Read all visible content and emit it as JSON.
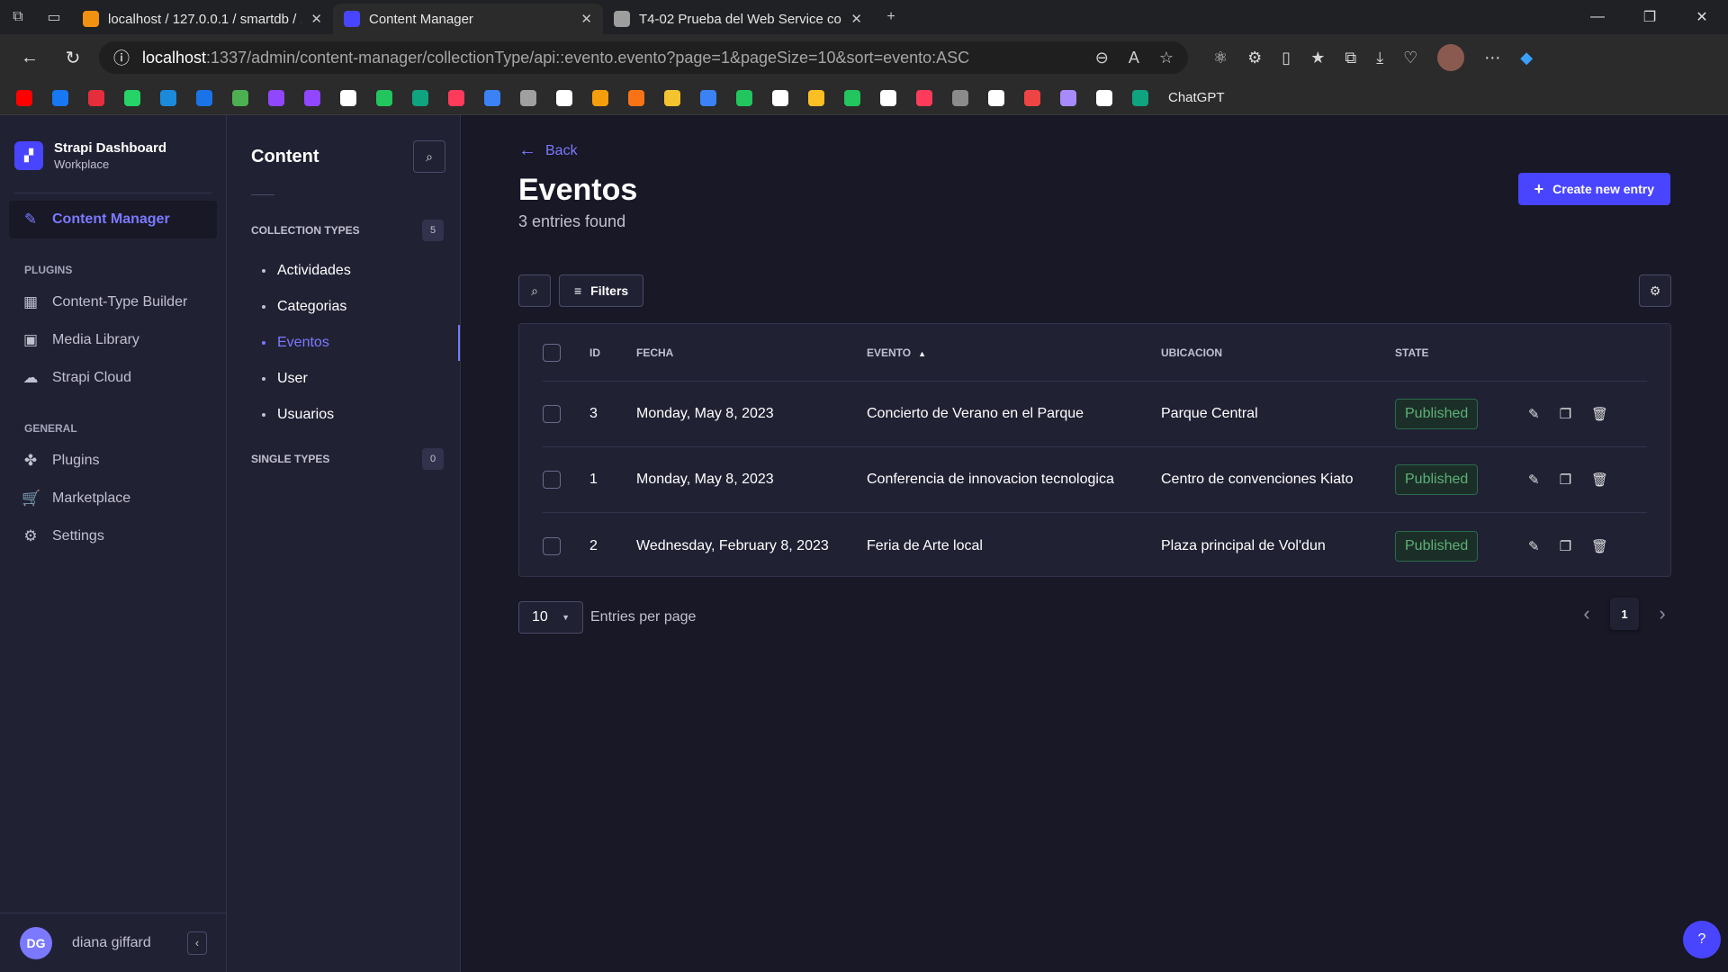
{
  "browser": {
    "tabs": [
      {
        "title": "localhost / 127.0.0.1 / smartdb / ...",
        "favicon_color": "#f29111",
        "active": false
      },
      {
        "title": "Content Manager",
        "favicon_color": "#4945ff",
        "active": true
      },
      {
        "title": "T4-02 Prueba del Web Service co...",
        "favicon_color": "#9e9e9e",
        "active": false
      }
    ],
    "url_host": "localhost",
    "url_rest": ":1337/admin/content-manager/collectionType/api::evento.evento?page=1&pageSize=10&sort=evento:ASC",
    "bookmarks": {
      "colors": [
        "#ff0000",
        "#1877f2",
        "#e62d3c",
        "#25d366",
        "#1c8adb",
        "#1a73e8",
        "#4caf50",
        "#9146ff",
        "#9146ff",
        "#ffffff",
        "#22c55e",
        "#10a37f",
        "#ff3b5c",
        "#3b82f6",
        "#a0a0a0",
        "#ffffff",
        "#f59e0b",
        "#f97316",
        "#f4c430",
        "#3b82f6",
        "#22c55e",
        "#ffffff",
        "#fbbf24",
        "#22c55e",
        "#ffffff",
        "#ff3b5c",
        "#8b8b8b",
        "#ffffff",
        "#ef4444",
        "#a78bfa",
        "#ffffff",
        "#10a37f"
      ],
      "chatgpt_label": "ChatGPT"
    }
  },
  "brand": {
    "title": "Strapi Dashboard",
    "subtitle": "Workplace"
  },
  "main_nav": {
    "content_manager": "Content Manager",
    "plugins_section": "PLUGINS",
    "plugins": [
      "Content-Type Builder",
      "Media Library",
      "Strapi Cloud"
    ],
    "general_section": "GENERAL",
    "general": [
      "Plugins",
      "Marketplace",
      "Settings"
    ]
  },
  "user": {
    "initials": "DG",
    "name": "diana giffard"
  },
  "sub_nav": {
    "title": "Content",
    "collection_types_label": "COLLECTION TYPES",
    "collection_types_count": "5",
    "collection_types": [
      "Actividades",
      "Categorias",
      "Eventos",
      "User",
      "Usuarios"
    ],
    "single_types_label": "SINGLE TYPES",
    "single_types_count": "0"
  },
  "page": {
    "back_label": "Back",
    "title": "Eventos",
    "subtitle": "3 entries found",
    "create_label": "Create new entry",
    "filters_label": "Filters"
  },
  "table": {
    "headers": {
      "id": "ID",
      "fecha": "FECHA",
      "evento": "EVENTO",
      "ubicacion": "UBICACION",
      "state": "STATE"
    },
    "rows": [
      {
        "id": "3",
        "fecha": "Monday, May 8, 2023",
        "evento": "Concierto de Verano en el Parque",
        "ubicacion": "Parque Central",
        "state": "Published"
      },
      {
        "id": "1",
        "fecha": "Monday, May 8, 2023",
        "evento": "Conferencia de innovacion tecnologica",
        "ubicacion": "Centro de convenciones Kiato",
        "state": "Published"
      },
      {
        "id": "2",
        "fecha": "Wednesday, February 8, 2023",
        "evento": "Feria de Arte local",
        "ubicacion": "Plaza principal de Vol'dun",
        "state": "Published"
      }
    ]
  },
  "pagination": {
    "page_size": "10",
    "per_page_label": "Entries per page",
    "current_page": "1"
  },
  "colors": {
    "accent": "#4945ff",
    "accent_text": "#7b79ff",
    "success": "#5cb176",
    "bg": "#181826",
    "panel": "#212134"
  }
}
